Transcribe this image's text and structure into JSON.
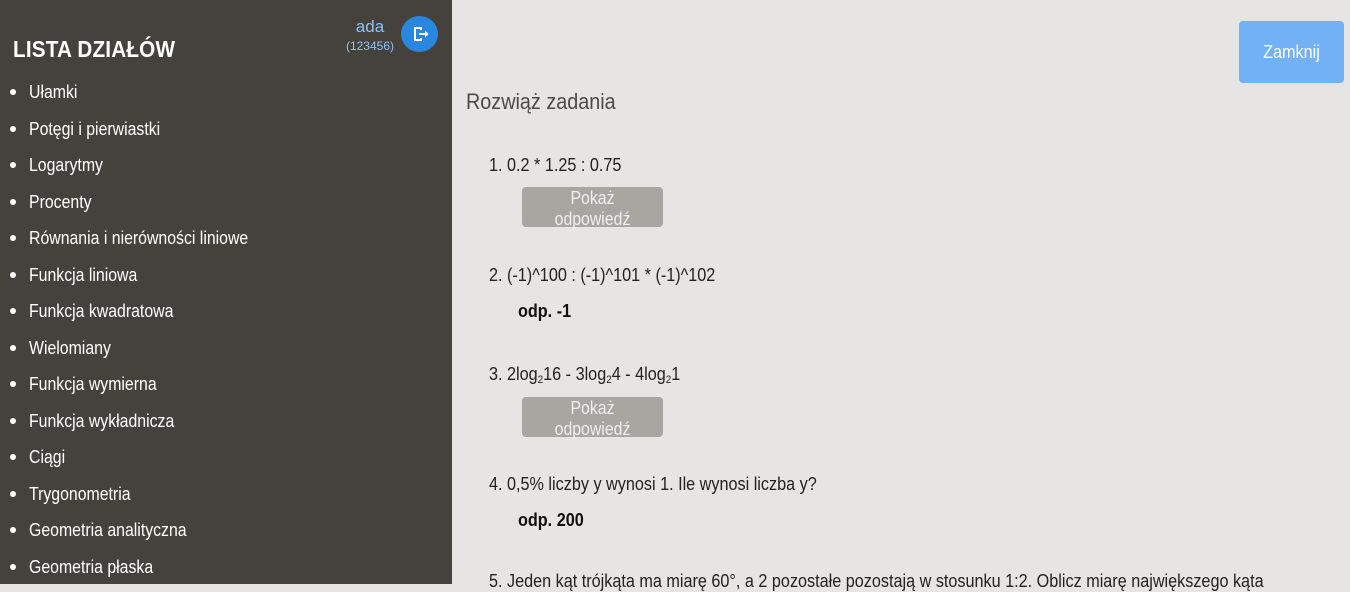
{
  "sidebar": {
    "title": "LISTA DZIAŁÓW",
    "user": {
      "name": "ada",
      "id": "(123456)"
    },
    "logout_icon": "logout-icon",
    "items": [
      "Ułamki",
      "Potęgi i pierwiastki",
      "Logarytmy",
      "Procenty",
      "Równania i nierówności liniowe",
      "Funkcja liniowa",
      "Funkcja kwadratowa",
      "Wielomiany",
      "Funkcja wymierna",
      "Funkcja wykładnicza",
      "Ciągi",
      "Trygonometria",
      "Geometria analityczna",
      "Geometria płaska"
    ]
  },
  "main": {
    "close_label": "Zamknij",
    "title": "Rozwiąż zadania",
    "show_answer_label": "Pokaż odpowiedź",
    "tasks": [
      {
        "text": "1. 0.2 * 1.25 : 0.75"
      },
      {
        "text": "2. (-1)^100 : (-1)^101 * (-1)^102",
        "answer": "odp. -1"
      },
      {
        "prefix": "3. 2log",
        "p1": "16 - 3log",
        "p2": "4 - 4log",
        "p3": "1",
        "sub": "2"
      },
      {
        "text": "4. 0,5% liczby y wynosi 1. Ile wynosi liczba y?",
        "answer": "odp. 200"
      },
      {
        "text": "5. Jeden kąt trójkąta ma miarę 60°, a 2 pozostałe pozostają w stosunku 1:2. Oblicz miarę największego kąta"
      }
    ]
  },
  "colors": {
    "sidebar_bg": "#45413c",
    "main_bg": "#e6e5e3",
    "accent": "#2a87e0",
    "close_button": "#73b1f6",
    "answer_button": "#a9a6a2"
  }
}
